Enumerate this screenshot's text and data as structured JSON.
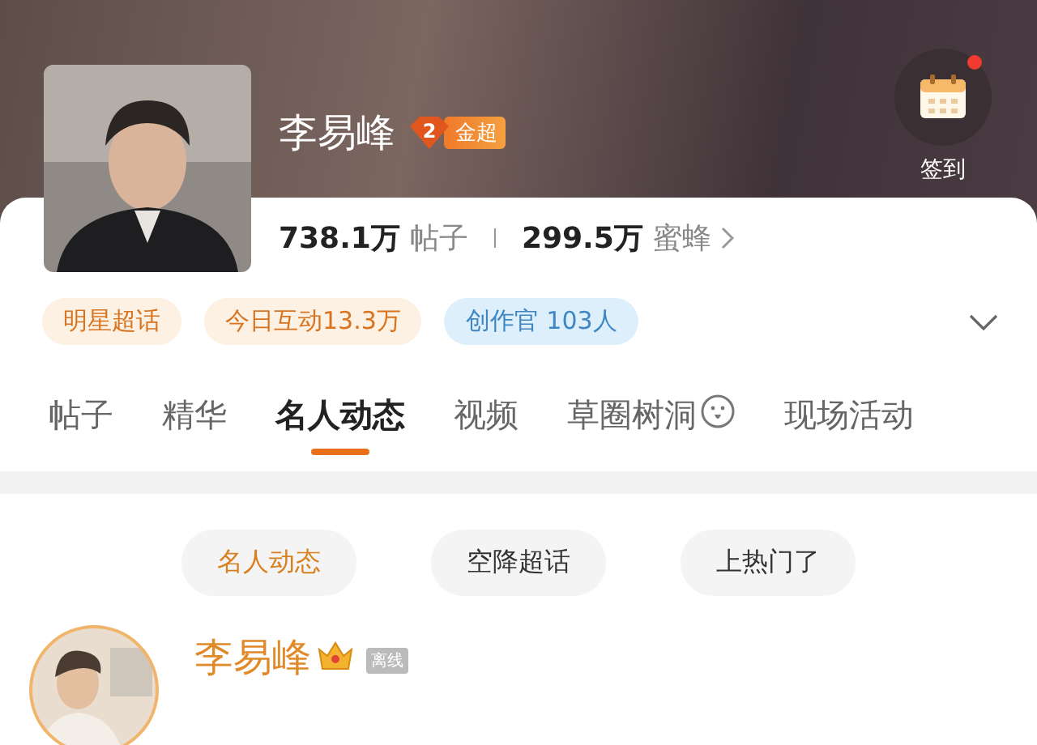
{
  "topic": {
    "name": "李易峰",
    "badge": "金超",
    "badge_level": "2"
  },
  "sign_in": {
    "label": "签到",
    "notification": true
  },
  "stats": [
    {
      "count": "738.1万",
      "unit": "帖子"
    },
    {
      "count": "299.5万",
      "unit": "蜜蜂"
    }
  ],
  "chips": [
    {
      "label": "明星超话",
      "kind": "orange"
    },
    {
      "label": "今日互动13.3万",
      "kind": "orange"
    },
    {
      "label": "创作官 103人",
      "kind": "blue"
    }
  ],
  "tabs": [
    {
      "label": "帖子",
      "selected": false,
      "icon": false
    },
    {
      "label": "精华",
      "selected": false,
      "icon": false
    },
    {
      "label": "名人动态",
      "selected": true,
      "icon": false
    },
    {
      "label": "视频",
      "selected": false,
      "icon": false
    },
    {
      "label": "草圈树洞",
      "selected": false,
      "icon": true
    },
    {
      "label": "现场活动",
      "selected": false,
      "icon": false
    }
  ],
  "filters": [
    {
      "label": "名人动态",
      "selected": true
    },
    {
      "label": "空降超话",
      "selected": false
    },
    {
      "label": "上热门了",
      "selected": false
    }
  ],
  "post": {
    "author": "李易峰",
    "crown": true,
    "status": "离线"
  }
}
